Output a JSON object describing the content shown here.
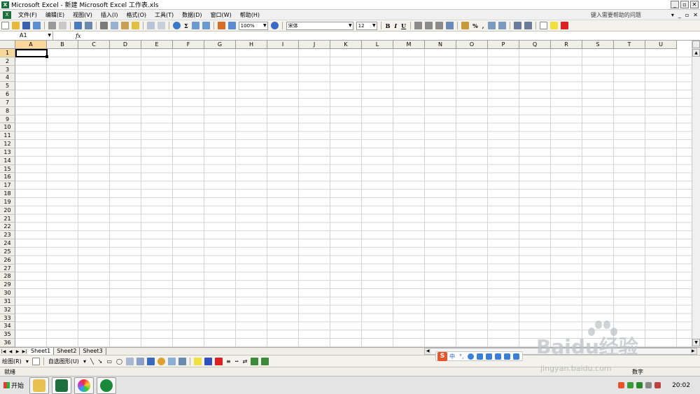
{
  "window": {
    "title": "Microsoft Excel - 新建 Microsoft Excel 工作表.xls",
    "minimize": "_",
    "restore": "▫",
    "close": "✕"
  },
  "menu": {
    "items": [
      "文件(F)",
      "编辑(E)",
      "视图(V)",
      "插入(I)",
      "格式(O)",
      "工具(T)",
      "数据(D)",
      "窗口(W)",
      "帮助(H)"
    ],
    "help_placeholder": "键入需要帮助的问题",
    "doc_minimize": "_",
    "doc_restore": "▫",
    "doc_close": "✕"
  },
  "toolbar": {
    "zoom": "100%",
    "font_name": "宋体",
    "font_size": "12",
    "bold": "B",
    "italic": "I",
    "underline": "U",
    "percent": "%",
    "comma": ","
  },
  "formula_bar": {
    "name_box": "A1",
    "fx": "fx",
    "formula": ""
  },
  "grid": {
    "columns": [
      "A",
      "B",
      "C",
      "D",
      "E",
      "F",
      "G",
      "H",
      "I",
      "J",
      "K",
      "L",
      "M",
      "N",
      "O",
      "P",
      "Q",
      "R",
      "S",
      "T",
      "U"
    ],
    "rows": [
      "1",
      "2",
      "3",
      "4",
      "5",
      "6",
      "7",
      "8",
      "9",
      "10",
      "11",
      "12",
      "13",
      "14",
      "15",
      "16",
      "17",
      "18",
      "19",
      "20",
      "21",
      "22",
      "23",
      "24",
      "25",
      "26",
      "27",
      "28",
      "29",
      "30",
      "31",
      "32",
      "33",
      "34",
      "35",
      "36"
    ],
    "active_cell": "A1"
  },
  "sheets": {
    "tabs": [
      "Sheet1",
      "Sheet2",
      "Sheet3"
    ],
    "active": "Sheet1"
  },
  "drawbar": {
    "draw": "绘图(R)",
    "autoshapes": "自选图形(U)"
  },
  "ime": {
    "logo": "S",
    "mode": "中",
    "punct": "°,"
  },
  "status": {
    "ready": "就绪",
    "num": "数字"
  },
  "taskbar": {
    "start": "开始",
    "clock": "20:02"
  },
  "watermark": {
    "main": "Baidu经验",
    "sub": "jingyan.baidu.com"
  },
  "colors": {
    "excel_green": "#1d6f3b",
    "header_selected": "#f9d69a",
    "ime_orange": "#e8542a"
  }
}
